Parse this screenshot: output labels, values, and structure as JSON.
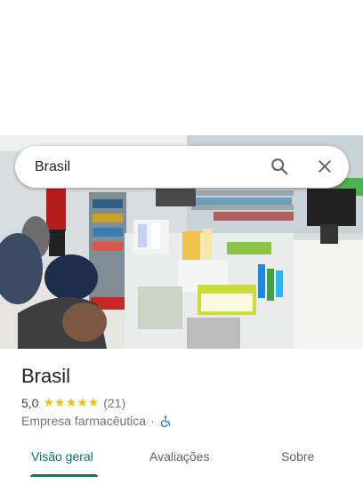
{
  "search": {
    "query": "Brasil"
  },
  "place": {
    "title": "Brasil",
    "rating": "5,0",
    "stars": "★★★★★",
    "review_count": "(21)",
    "category": "Empresa farmacêutica",
    "separator": "·"
  },
  "tabs": [
    {
      "label": "Visão geral",
      "active": true
    },
    {
      "label": "Avaliações",
      "active": false
    },
    {
      "label": "Sobre",
      "active": false
    }
  ],
  "colors": {
    "accent": "#00786f",
    "star": "#fbbc04",
    "accessibility": "#1a73e8"
  }
}
